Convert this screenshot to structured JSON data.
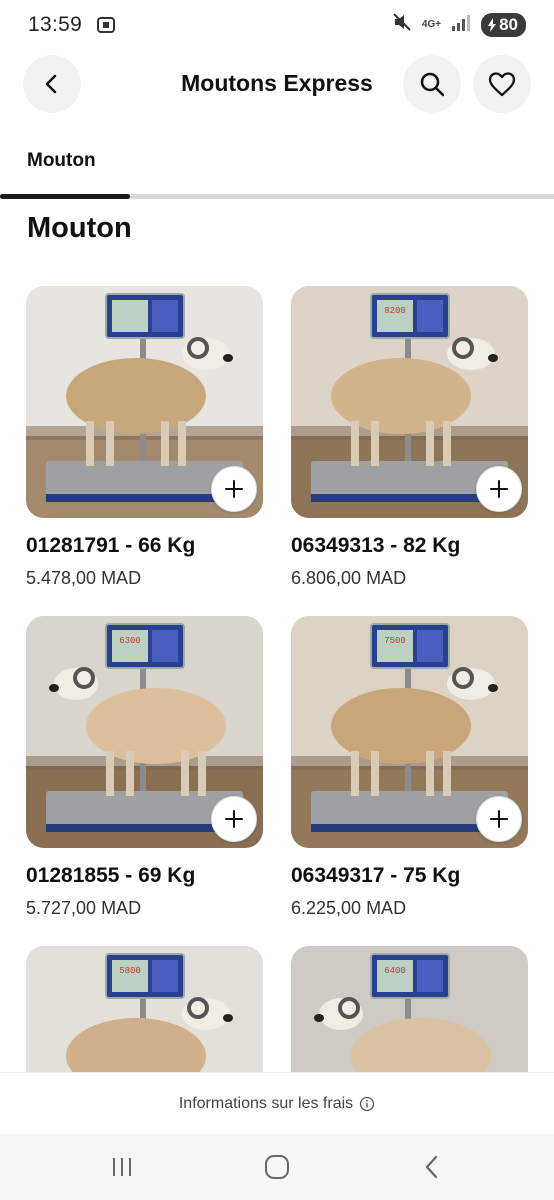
{
  "status": {
    "time": "13:59",
    "network": "4G+",
    "battery": "80"
  },
  "header": {
    "title": "Moutons Express",
    "icons": {
      "back": "back-arrow-icon",
      "search": "search-icon",
      "favorite": "heart-icon"
    }
  },
  "tabs": [
    {
      "label": "Mouton",
      "active": true
    }
  ],
  "section": {
    "title": "Mouton"
  },
  "products": [
    {
      "name": "01281791 - 66 Kg",
      "price": "5.478,00 MAD"
    },
    {
      "name": "06349313 - 82 Kg",
      "price": "6.806,00 MAD"
    },
    {
      "name": "01281855 - 69 Kg",
      "price": "5.727,00 MAD"
    },
    {
      "name": "06349317 - 75 Kg",
      "price": "6.225,00 MAD"
    },
    {
      "name": "",
      "price": ""
    },
    {
      "name": "",
      "price": ""
    }
  ],
  "scales": [
    "",
    "8200",
    "6300",
    "7500",
    "5800",
    "6400"
  ],
  "fees": {
    "label": "Informations sur les frais"
  },
  "navbar": {
    "icons": [
      "recent-apps-icon",
      "home-icon",
      "back-icon"
    ]
  },
  "colors": {
    "accent": "#1c1c1c",
    "background": "#ffffff",
    "button_bg": "#f2f2f2"
  }
}
